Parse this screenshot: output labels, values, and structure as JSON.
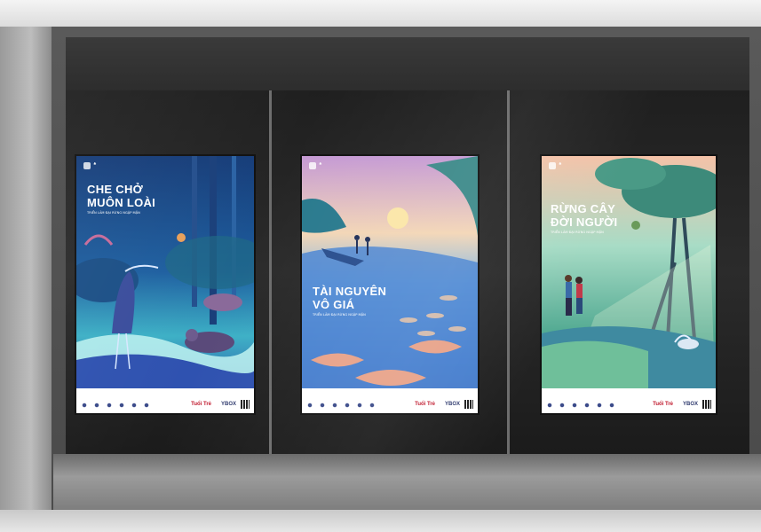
{
  "scene": {
    "description_free": true
  },
  "posters": [
    {
      "id": "poster-1",
      "title_line1": "CHE CHỞ",
      "title_line2": "MUÔN LOÀI",
      "subtitle": "TRIỂN LÃM ĐẠI RỪNG NGẬP MẶN",
      "footer_logo_1": "Tuổi Trẻ",
      "footer_logo_2": "YBOX"
    },
    {
      "id": "poster-2",
      "title_line1": "TÀI NGUYÊN",
      "title_line2": "VÔ GIÁ",
      "subtitle": "TRIỂN LÃM ĐẠI RỪNG NGẬP MẶN",
      "footer_logo_1": "Tuổi Trẻ",
      "footer_logo_2": "YBOX"
    },
    {
      "id": "poster-3",
      "title_line1": "RỪNG CÂY",
      "title_line2": "ĐỜI NGƯỜI",
      "subtitle": "TRIỂN LÃM ĐẠI RỪNG NGẬP MẶN",
      "footer_logo_1": "Tuổi Trẻ",
      "footer_logo_2": "YBOX"
    }
  ],
  "colors": {
    "poster1_bg": "#1d4f8a",
    "poster2_bg": "#7fa6d8",
    "poster3_bg": "#7cc3b4"
  }
}
